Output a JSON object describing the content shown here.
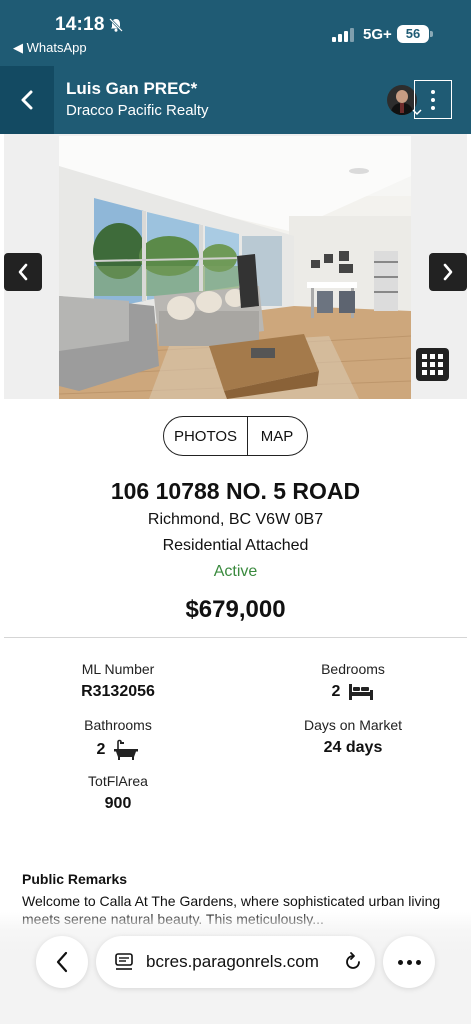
{
  "status_bar": {
    "time": "14:18",
    "back_app": "◀ WhatsApp",
    "network": "5G+",
    "battery": "56"
  },
  "header": {
    "agent_name": "Luis Gan PREC*",
    "company": "Dracco Pacific Realty"
  },
  "toggle": {
    "photos_label": "PHOTOS",
    "map_label": "MAP"
  },
  "listing": {
    "address": "106 10788 NO. 5 ROAD",
    "city_line": "Richmond, BC V6W 0B7",
    "property_type": "Residential Attached",
    "status": "Active",
    "price": "$679,000"
  },
  "facts": {
    "ml_label": "ML Number",
    "ml_value": "R3132056",
    "bedrooms_label": "Bedrooms",
    "bedrooms_value": "2",
    "bathrooms_label": "Bathrooms",
    "bathrooms_value": "2",
    "dom_label": "Days on Market",
    "dom_value": "24 days",
    "area_label": "TotFlArea",
    "area_value": "900"
  },
  "remarks": {
    "title": "Public Remarks",
    "text": "Welcome to Calla At The Gardens, where sophisticated urban living meets serene natural beauty. This meticulously..."
  },
  "browser": {
    "url": "bcres.paragonrels.com"
  },
  "colors": {
    "header_bg": "#1f5b74",
    "status_active": "#3a8a3e"
  },
  "icons": [
    "bell-slash-icon",
    "signal-icon",
    "back-chevron-icon",
    "kebab-menu-icon",
    "prev-arrow-icon",
    "next-arrow-icon",
    "grid-icon",
    "bed-icon",
    "bathtub-icon",
    "site-info-icon",
    "reload-icon",
    "more-icon"
  ]
}
